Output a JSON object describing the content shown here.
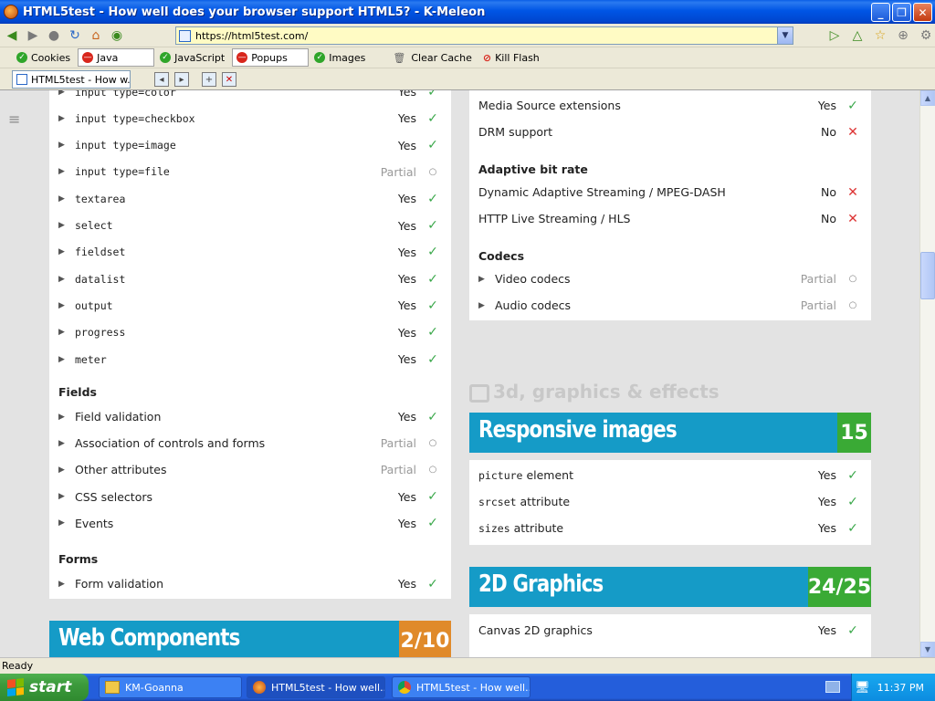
{
  "window": {
    "title": "HTML5test - How well does your browser support HTML5? - K-Meleon",
    "controls": [
      "_",
      "❐",
      "✕"
    ]
  },
  "navbar": {
    "url": "https://html5test.com/"
  },
  "prefbar": {
    "items": [
      {
        "label": "Cookies",
        "state": "ok"
      },
      {
        "label": "Java",
        "state": "no"
      },
      {
        "label": "JavaScript",
        "state": "ok"
      },
      {
        "label": "Popups",
        "state": "no"
      },
      {
        "label": "Images",
        "state": "ok"
      },
      {
        "label": "Clear Cache",
        "state": "trash"
      },
      {
        "label": "Kill Flash",
        "state": "kill"
      }
    ]
  },
  "tabbar": {
    "active_tab": "HTML5test - How w..."
  },
  "left_panel": {
    "rows_top": [
      {
        "label": "input type=color",
        "result": "Yes",
        "mark": "check",
        "mono": true
      },
      {
        "label": "input type=checkbox",
        "result": "Yes",
        "mark": "check",
        "mono": true
      },
      {
        "label": "input type=image",
        "result": "Yes",
        "mark": "check",
        "mono": true
      },
      {
        "label": "input type=file",
        "result": "Partial",
        "mark": "circle",
        "mono": true
      },
      {
        "label": "textarea",
        "result": "Yes",
        "mark": "check",
        "mono": true
      },
      {
        "label": "select",
        "result": "Yes",
        "mark": "check",
        "mono": true
      },
      {
        "label": "fieldset",
        "result": "Yes",
        "mark": "check",
        "mono": true
      },
      {
        "label": "datalist",
        "result": "Yes",
        "mark": "check",
        "mono": true
      },
      {
        "label": "output",
        "result": "Yes",
        "mark": "check",
        "mono": true
      },
      {
        "label": "progress",
        "result": "Yes",
        "mark": "check",
        "mono": true
      },
      {
        "label": "meter",
        "result": "Yes",
        "mark": "check",
        "mono": true
      }
    ],
    "fields_heading": "Fields",
    "rows_fields": [
      {
        "label": "Field validation",
        "result": "Yes",
        "mark": "check"
      },
      {
        "label": "Association of controls and forms",
        "result": "Partial",
        "mark": "circle"
      },
      {
        "label": "Other attributes",
        "result": "Partial",
        "mark": "circle"
      },
      {
        "label": "CSS selectors",
        "result": "Yes",
        "mark": "check"
      },
      {
        "label": "Events",
        "result": "Yes",
        "mark": "check"
      }
    ],
    "forms_heading": "Forms",
    "rows_forms": [
      {
        "label": "Form validation",
        "result": "Yes",
        "mark": "check"
      }
    ]
  },
  "web_components": {
    "title": "Web Components",
    "score": "2/10",
    "color": "#159bc7",
    "score_color": "#e08a2a"
  },
  "right_panel": {
    "rows_top": [
      {
        "label": "Media Source extensions",
        "result": "Yes",
        "mark": "check",
        "expand": false
      },
      {
        "label": "DRM support",
        "result": "No",
        "mark": "cross",
        "expand": false
      }
    ],
    "abr_heading": "Adaptive bit rate",
    "rows_abr": [
      {
        "label": "Dynamic Adaptive Streaming / MPEG-DASH",
        "result": "No",
        "mark": "cross",
        "expand": false
      },
      {
        "label": "HTTP Live Streaming / HLS",
        "result": "No",
        "mark": "cross",
        "expand": false
      }
    ],
    "codecs_heading": "Codecs",
    "rows_codecs": [
      {
        "label": "Video codecs",
        "result": "Partial",
        "mark": "circle",
        "expand": true
      },
      {
        "label": "Audio codecs",
        "result": "Partial",
        "mark": "circle",
        "expand": true
      }
    ]
  },
  "section_3d": "3d, graphics & effects",
  "responsive_images": {
    "title": "Responsive images",
    "score": "15",
    "color": "#159bc7",
    "score_color": "#3aaa35",
    "rows": [
      {
        "code": "picture",
        "label": " element",
        "result": "Yes",
        "mark": "check"
      },
      {
        "code": "srcset",
        "label": " attribute",
        "result": "Yes",
        "mark": "check"
      },
      {
        "code": "sizes",
        "label": " attribute",
        "result": "Yes",
        "mark": "check"
      }
    ]
  },
  "graphics_2d": {
    "title": "2D Graphics",
    "score": "24/25",
    "color": "#159bc7",
    "score_color": "#3aaa35",
    "rows": [
      {
        "label": "Canvas 2D graphics",
        "result": "Yes",
        "mark": "check"
      }
    ]
  },
  "statusbar": {
    "text": "Ready"
  },
  "taskbar": {
    "start_label": "start",
    "tasks": [
      {
        "label": "KM-Goanna",
        "icon": "folder-icon"
      },
      {
        "label": "HTML5test - How well...",
        "icon": "kmeleon-icon"
      },
      {
        "label": "HTML5test - How well...",
        "icon": "chrome-icon"
      }
    ],
    "clock": "11:37 PM"
  }
}
